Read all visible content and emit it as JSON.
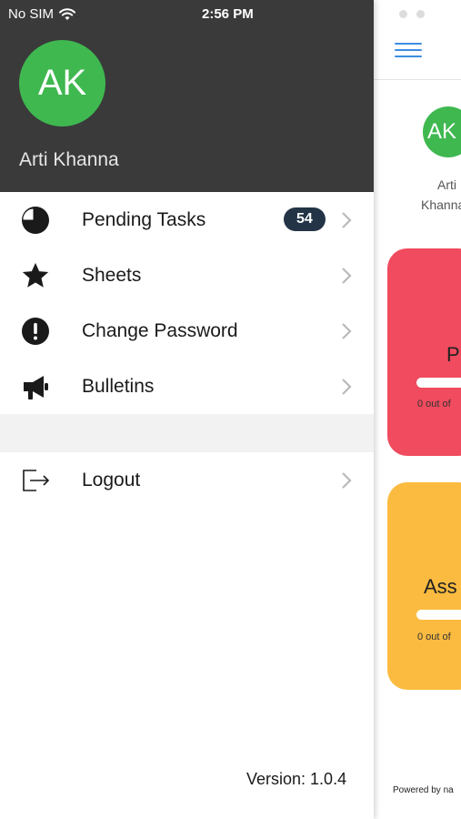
{
  "status_bar": {
    "carrier": "No SIM",
    "time": "2:56 PM"
  },
  "drawer": {
    "avatar_initials": "AK",
    "user_name": "Arti Khanna",
    "menu": [
      {
        "label": "Pending Tasks",
        "icon": "pie-chart-icon",
        "badge": "54"
      },
      {
        "label": "Sheets",
        "icon": "star-icon"
      },
      {
        "label": "Change Password",
        "icon": "alert-circle-icon"
      },
      {
        "label": "Bulletins",
        "icon": "megaphone-icon"
      }
    ],
    "logout_label": "Logout",
    "version": "Version: 1.0.4"
  },
  "main": {
    "avatar_initials": "AK",
    "user_name_line1": "Arti",
    "user_name_line2": "Khanna",
    "card1_title": "P",
    "card1_sub": "0 out of",
    "card2_title": "Ass",
    "card2_sub": "0 out of",
    "powered_by": "Powered by na"
  },
  "colors": {
    "header_bg": "#3a3a3a",
    "avatar_green": "#3fb850",
    "badge_bg": "#233446",
    "card_red": "#f04b5e",
    "card_yellow": "#fbbb40",
    "hamburger_blue": "#3d8de0"
  }
}
